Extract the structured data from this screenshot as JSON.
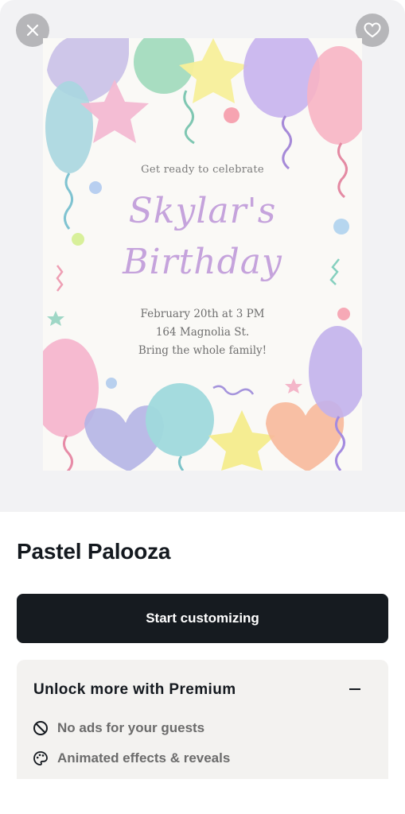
{
  "preview": {
    "close_icon": "close-icon",
    "favorite_icon": "heart-icon",
    "invitation": {
      "eyebrow": "Get ready to celebrate",
      "name_line1": "Skylar's",
      "name_line2": "Birthday",
      "date_time": "February 20th at 3 PM",
      "address": "164 Magnolia St.",
      "note": "Bring the whole family!"
    }
  },
  "template": {
    "title": "Pastel Palooza"
  },
  "cta": {
    "label": "Start customizing"
  },
  "premium": {
    "title": "Unlock more with Premium",
    "features": [
      {
        "icon": "no-ads-icon",
        "label": "No ads for your guests"
      },
      {
        "icon": "palette-icon",
        "label": "Animated effects & reveals"
      }
    ]
  },
  "colors": {
    "cta_bg": "#161b20",
    "script_purple": "#c5a3dc"
  }
}
